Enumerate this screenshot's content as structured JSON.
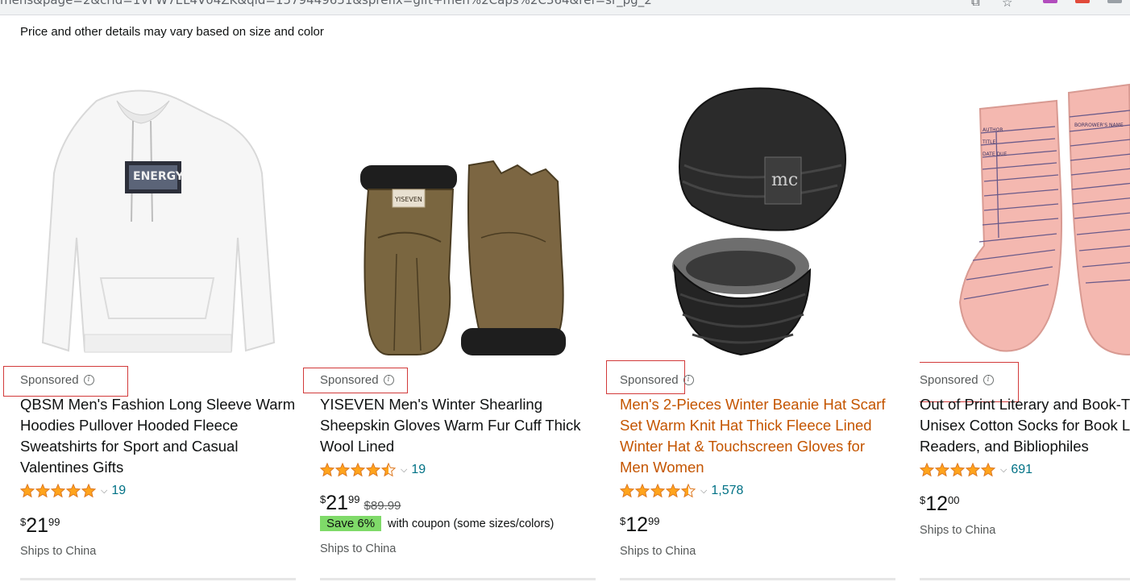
{
  "browser": {
    "url_fragment": "mens&page=2&crid=1VFW7EL4V04ZK&qid=1579449651&sprefix=gift+men%2Caps%2C364&ref=sr_pg_2"
  },
  "notice": "Price and other details may vary based on size and color",
  "sponsored_label": "Sponsored",
  "info_glyph": "i",
  "colors": {
    "star": "#ffa41c",
    "link": "#007185",
    "hover_title": "#c45500",
    "coupon": "#7fda69",
    "annotation_box": "#d23a3a"
  },
  "products": [
    {
      "title": "QBSM Men's Fashion Long Sleeve Warm Hoodies Pullover Hooded Fleece Sweatshirts for Sport and Casual Valentines Gifts",
      "rating": 5.0,
      "review_count": "19",
      "price_symbol": "$",
      "price_whole": "21",
      "price_fraction": "99",
      "list_price": "",
      "coupon_badge": "",
      "coupon_text": "",
      "shipping": "Ships to China",
      "image": "white-hoodie-image"
    },
    {
      "title": "YISEVEN Men's Winter Shearling Sheepskin Gloves Warm Fur Cuff Thick Wool Lined",
      "rating": 4.5,
      "review_count": "19",
      "price_symbol": "$",
      "price_whole": "21",
      "price_fraction": "99",
      "list_price": "$89.99",
      "coupon_badge": "Save 6%",
      "coupon_text": "with coupon (some sizes/colors)",
      "shipping": "Ships to China",
      "image": "leather-gloves-image"
    },
    {
      "title": "Men's 2-Pieces Winter Beanie Hat Scarf Set Warm Knit Hat Thick Fleece Lined Winter Hat & Touchscreen Gloves for Men Women",
      "rating": 4.5,
      "review_count": "1,578",
      "price_symbol": "$",
      "price_whole": "12",
      "price_fraction": "99",
      "list_price": "",
      "coupon_badge": "",
      "coupon_text": "",
      "shipping": "Ships to China",
      "image": "beanie-scarf-image"
    },
    {
      "title": "Out of Print Literary and Book-Themed Unisex Cotton Socks for Book Lovers, Readers, and Bibliophiles",
      "rating": 5.0,
      "review_count": "691",
      "price_symbol": "$",
      "price_whole": "12",
      "price_fraction": "00",
      "list_price": "",
      "coupon_badge": "",
      "coupon_text": "",
      "shipping": "Ships to China",
      "image": "library-card-socks-image"
    }
  ],
  "sock_print": {
    "line1": "AUTHOR",
    "line2": "TITLE",
    "line3": "DATE DUE",
    "line4": "BORROWER'S NAME"
  },
  "hoodie_print": "ENERGY",
  "glove_tag": "YISEVEN",
  "beanie_patch": "mc"
}
